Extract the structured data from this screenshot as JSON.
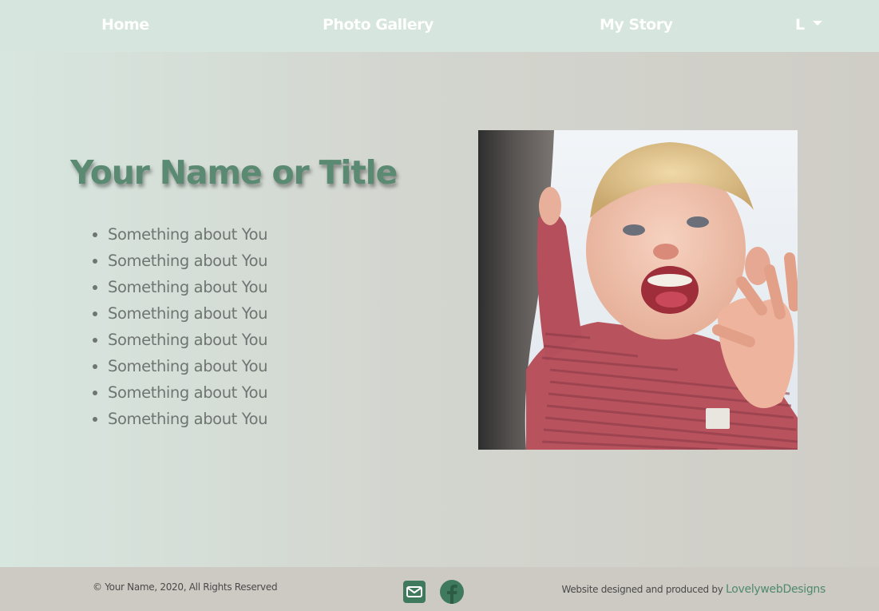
{
  "nav": {
    "items": [
      {
        "label": "Home"
      },
      {
        "label": "Photo Gallery"
      },
      {
        "label": "My Story"
      }
    ],
    "dropdown_label": "L",
    "background": "#d6e6de"
  },
  "main": {
    "title": "Your Name or Title",
    "title_color": "#5a8a72",
    "list_items": [
      "Something about You",
      "Something about You",
      "Something about You",
      "Something about You",
      "Something about You",
      "Something about You",
      "Something about You",
      "Something about You"
    ],
    "photo_icon": "portrait-photo"
  },
  "footer": {
    "copyright": "© Your Name, 2020, All Rights Reserved",
    "social": [
      {
        "icon": "mail-icon"
      },
      {
        "icon": "facebook-icon"
      }
    ],
    "credit_prefix": "Website designed and produced by",
    "credit_link": "LovelywebDesigns",
    "accent": "#3f7a5e"
  }
}
